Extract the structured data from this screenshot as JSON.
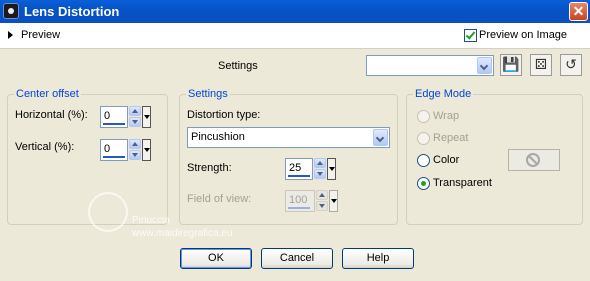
{
  "window": {
    "title": "Lens Distortion"
  },
  "preview": {
    "label": "Preview",
    "on_image_label": "Preview on Image",
    "on_image_checked": true
  },
  "settings_bar": {
    "label": "Settings",
    "preset_value": ""
  },
  "center_offset": {
    "legend": "Center offset",
    "horizontal_label": "Horizontal (%):",
    "horizontal_value": "0",
    "vertical_label": "Vertical (%):",
    "vertical_value": "0"
  },
  "settings": {
    "legend": "Settings",
    "type_label": "Distortion type:",
    "type_value": "Pincushion",
    "strength_label": "Strength:",
    "strength_value": "25",
    "fov_label": "Field of view:",
    "fov_value": "100"
  },
  "edge_mode": {
    "legend": "Edge Mode",
    "wrap": "Wrap",
    "repeat": "Repeat",
    "color": "Color",
    "transparent": "Transparent",
    "selected": "Transparent"
  },
  "buttons": {
    "ok": "OK",
    "cancel": "Cancel",
    "help": "Help"
  },
  "watermark": {
    "line1": "Pinuccia",
    "line2": "www.maidiregrafica.eu"
  },
  "colors": {
    "title_bar": "#0553c6",
    "legend": "#0046d5",
    "check": "#21a121"
  }
}
